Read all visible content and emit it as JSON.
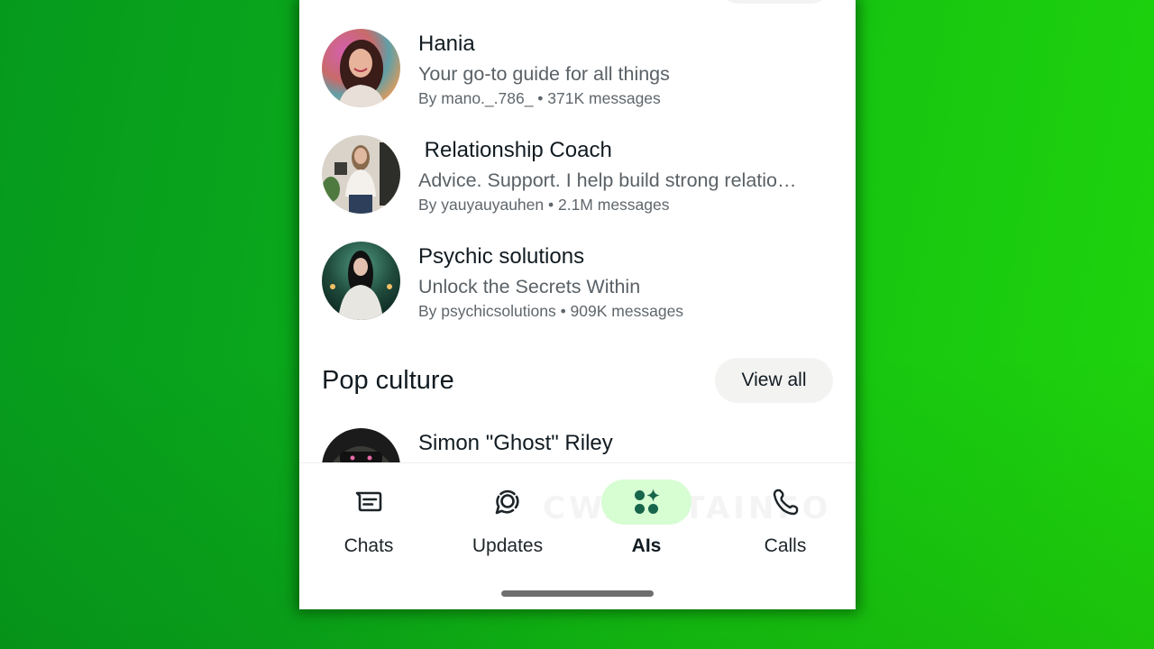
{
  "list": {
    "items": [
      {
        "name": "Hania",
        "description": "Your go-to guide for all things",
        "meta": "By mano._.786_ • 371K messages",
        "avatar": "avatar-woman-colorful-background"
      },
      {
        "name": " Relationship Coach",
        "description": "Advice. Support. I help build strong relatio…",
        "meta": "By yauyauyauhen • 2.1M messages",
        "avatar": "avatar-woman-living-room"
      },
      {
        "name": "Psychic solutions",
        "description": "Unlock the Secrets Within",
        "meta": "By psychicsolutions • 909K messages",
        "avatar": "avatar-woman-candles-green"
      }
    ]
  },
  "pop_culture": {
    "title": "Pop culture",
    "view_all_label": "View all",
    "items": [
      {
        "name": "Simon \"Ghost\" Riley",
        "avatar": "avatar-masked-soldier"
      }
    ]
  },
  "nav": {
    "items": [
      {
        "label": "Chats",
        "icon": "chat-icon",
        "active": false
      },
      {
        "label": "Updates",
        "icon": "updates-icon",
        "active": false
      },
      {
        "label": "AIs",
        "icon": "ai-sparkle-icon",
        "active": true
      },
      {
        "label": "Calls",
        "icon": "phone-icon",
        "active": false
      }
    ],
    "watermark": "CWABETAINFO"
  },
  "colors": {
    "accent_active_bg": "#d7fdd3",
    "accent_icon": "#17654a",
    "background_green": "#14c212"
  }
}
